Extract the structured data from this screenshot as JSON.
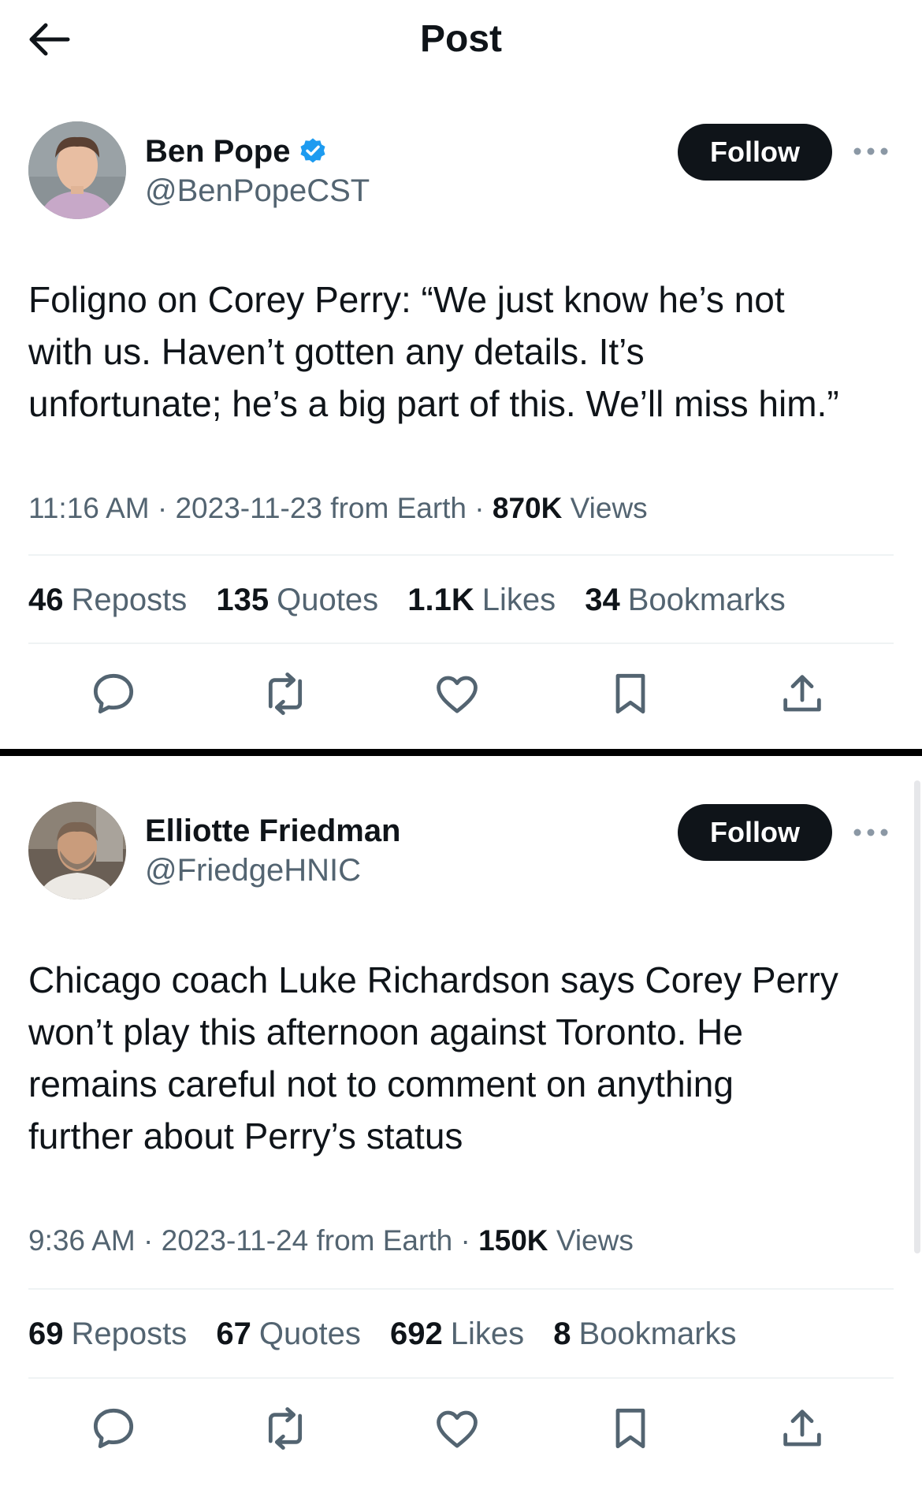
{
  "header": {
    "title": "Post"
  },
  "posts": [
    {
      "author": {
        "name": "Ben Pope",
        "handle": "@BenPopeCST",
        "verified": true
      },
      "follow_label": "Follow",
      "text": "Foligno on Corey Perry: “We just know he’s not\nwith us. Haven’t gotten any details. It’s\nunfortunate; he’s a big part of this. We’ll miss him.”",
      "meta": {
        "time": "11:16 AM",
        "date": "2023-11-23",
        "source": "from Earth",
        "views_count": "870K",
        "views_label": "Views"
      },
      "stats": [
        {
          "count": "46",
          "label": "Reposts"
        },
        {
          "count": "135",
          "label": "Quotes"
        },
        {
          "count": "1.1K",
          "label": "Likes"
        },
        {
          "count": "34",
          "label": "Bookmarks"
        }
      ]
    },
    {
      "author": {
        "name": "Elliotte Friedman",
        "handle": "@FriedgeHNIC",
        "verified": false
      },
      "follow_label": "Follow",
      "text": "Chicago coach Luke Richardson says Corey Perry\nwon’t play this afternoon against Toronto. He\nremains careful not to comment on anything\nfurther about Perry’s status",
      "meta": {
        "time": "9:36 AM",
        "date": "2023-11-24",
        "source": "from Earth",
        "views_count": "150K",
        "views_label": "Views"
      },
      "stats": [
        {
          "count": "69",
          "label": "Reposts"
        },
        {
          "count": "67",
          "label": "Quotes"
        },
        {
          "count": "692",
          "label": "Likes"
        },
        {
          "count": "8",
          "label": "Bookmarks"
        }
      ]
    }
  ],
  "icons": {
    "back": "arrow-left-icon",
    "verified": "verified-badge-icon",
    "more": "more-horizontal-icon",
    "actions": [
      "reply-icon",
      "repost-icon",
      "like-icon",
      "bookmark-icon",
      "share-icon"
    ]
  },
  "colors": {
    "text": "#0f1419",
    "secondary": "#536471",
    "verified": "#1d9bf0",
    "button": "#0f1419"
  }
}
